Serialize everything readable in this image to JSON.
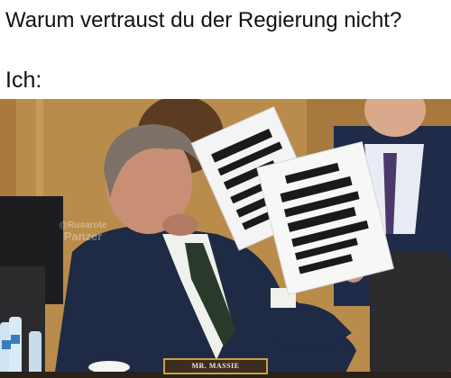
{
  "caption": {
    "line1": "Warum vertraust du der Regierung nicht?",
    "line2": "Ich:"
  },
  "photo": {
    "nameplate": "MR. MASSIE",
    "watermark_handle": "@Rusarote",
    "watermark_name": "Panzer"
  },
  "colors": {
    "background": "#ffffff",
    "caption_text": "#111111",
    "wood_panel": "#b88a4a",
    "suit": "#1f2a44",
    "paper": "#f4f4f4",
    "redaction": "#1a1a1a"
  }
}
